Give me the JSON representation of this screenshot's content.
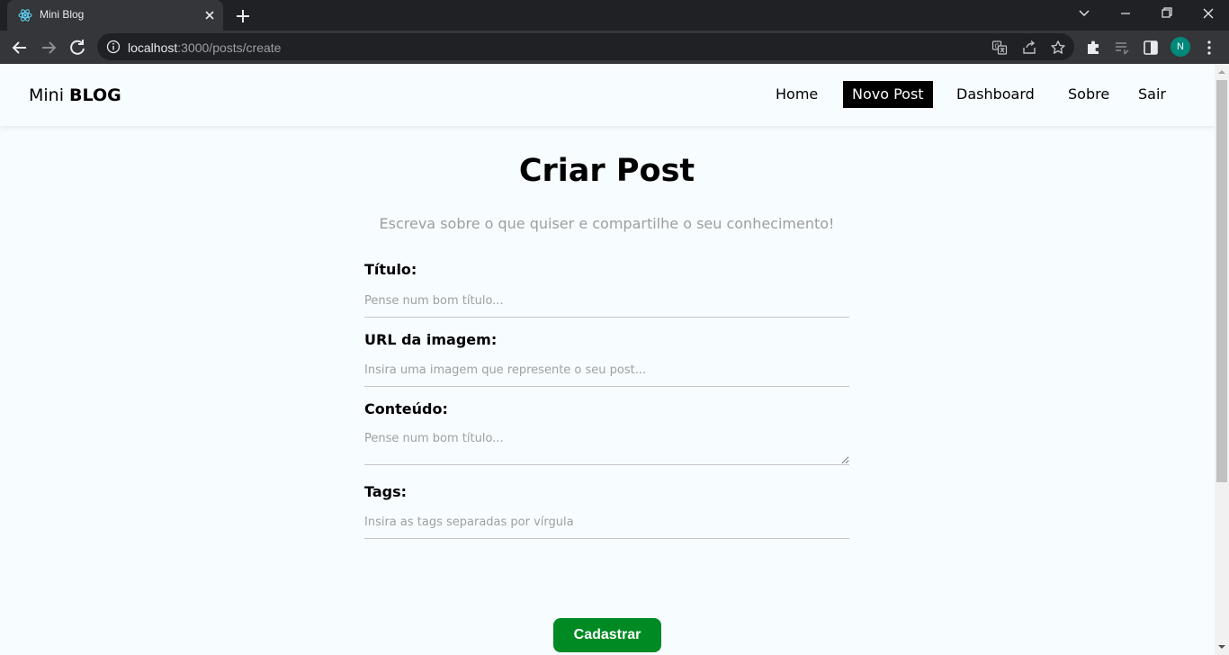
{
  "browser": {
    "tab_title": "Mini Blog",
    "url_host": "localhost",
    "url_path": ":3000/posts/create",
    "profile_initial": "N"
  },
  "navbar": {
    "brand_light": "Mini",
    "brand_bold": "BLOG",
    "links": [
      {
        "label": "Home",
        "active": false
      },
      {
        "label": "Novo Post",
        "active": true
      },
      {
        "label": "Dashboard",
        "active": false
      },
      {
        "label": "Sobre",
        "active": false
      },
      {
        "label": "Sair",
        "active": false
      }
    ]
  },
  "page": {
    "title": "Criar Post",
    "subtitle": "Escreva sobre o que quiser e compartilhe o seu conhecimento!"
  },
  "form": {
    "title": {
      "label": "Título:",
      "placeholder": "Pense num bom título..."
    },
    "image_url": {
      "label": "URL da imagem:",
      "placeholder": "Insira uma imagem que represente o seu post..."
    },
    "content": {
      "label": "Conteúdo:",
      "placeholder": "Pense num bom título..."
    },
    "tags": {
      "label": "Tags:",
      "placeholder": "Insira as tags separadas por vírgula"
    },
    "submit_label": "Cadastrar"
  },
  "colors": {
    "page_bg": "#f7fcff",
    "active_nav_bg": "#000000",
    "submit_bg": "#008a23",
    "browser_dark": "#202124",
    "browser_toolbar": "#35363a"
  },
  "icons": {
    "tab_favicon": "react-icon",
    "tab_close": "close-icon",
    "new_tab": "plus-icon",
    "back": "arrow-left-icon",
    "forward": "arrow-right-icon",
    "reload": "reload-icon",
    "site_info": "info-icon",
    "translate": "translate-icon",
    "share": "share-icon",
    "bookmark": "star-icon",
    "extensions": "puzzle-icon",
    "reading_list": "reading-list-icon",
    "side_panel": "side-panel-icon",
    "menu": "kebab-menu-icon"
  }
}
